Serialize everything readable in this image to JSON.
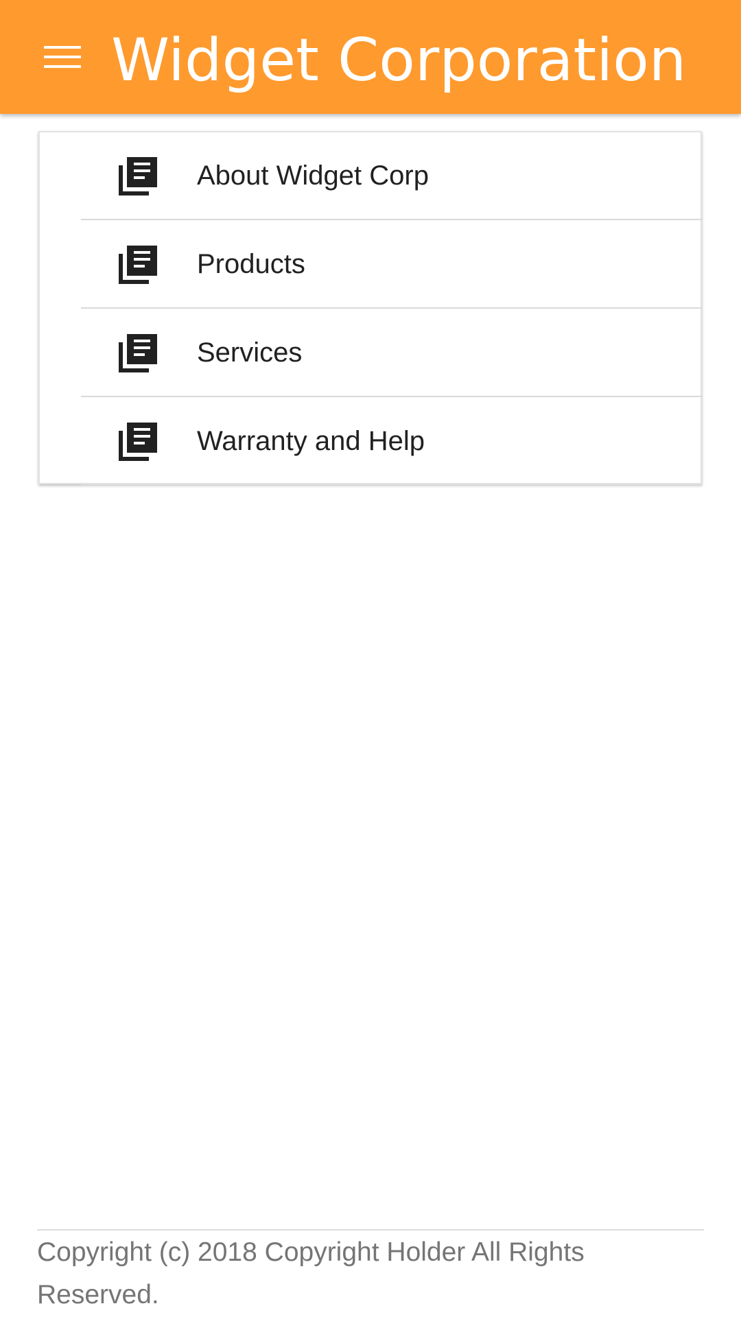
{
  "colors": {
    "app_bar": "#ff9a2e",
    "app_title": "#ffffff",
    "item_text": "#212121",
    "footer_text": "#757575"
  },
  "app_bar": {
    "menu_icon": "hamburger-menu-icon",
    "title": "Widget Corporation"
  },
  "nav": {
    "item_icon": "library-books-icon",
    "items": [
      {
        "label": "About Widget Corp"
      },
      {
        "label": "Products"
      },
      {
        "label": "Services"
      },
      {
        "label": "Warranty and Help"
      }
    ]
  },
  "footer": {
    "copyright": "Copyright (c) 2018 Copyright Holder All Rights Reserved."
  }
}
